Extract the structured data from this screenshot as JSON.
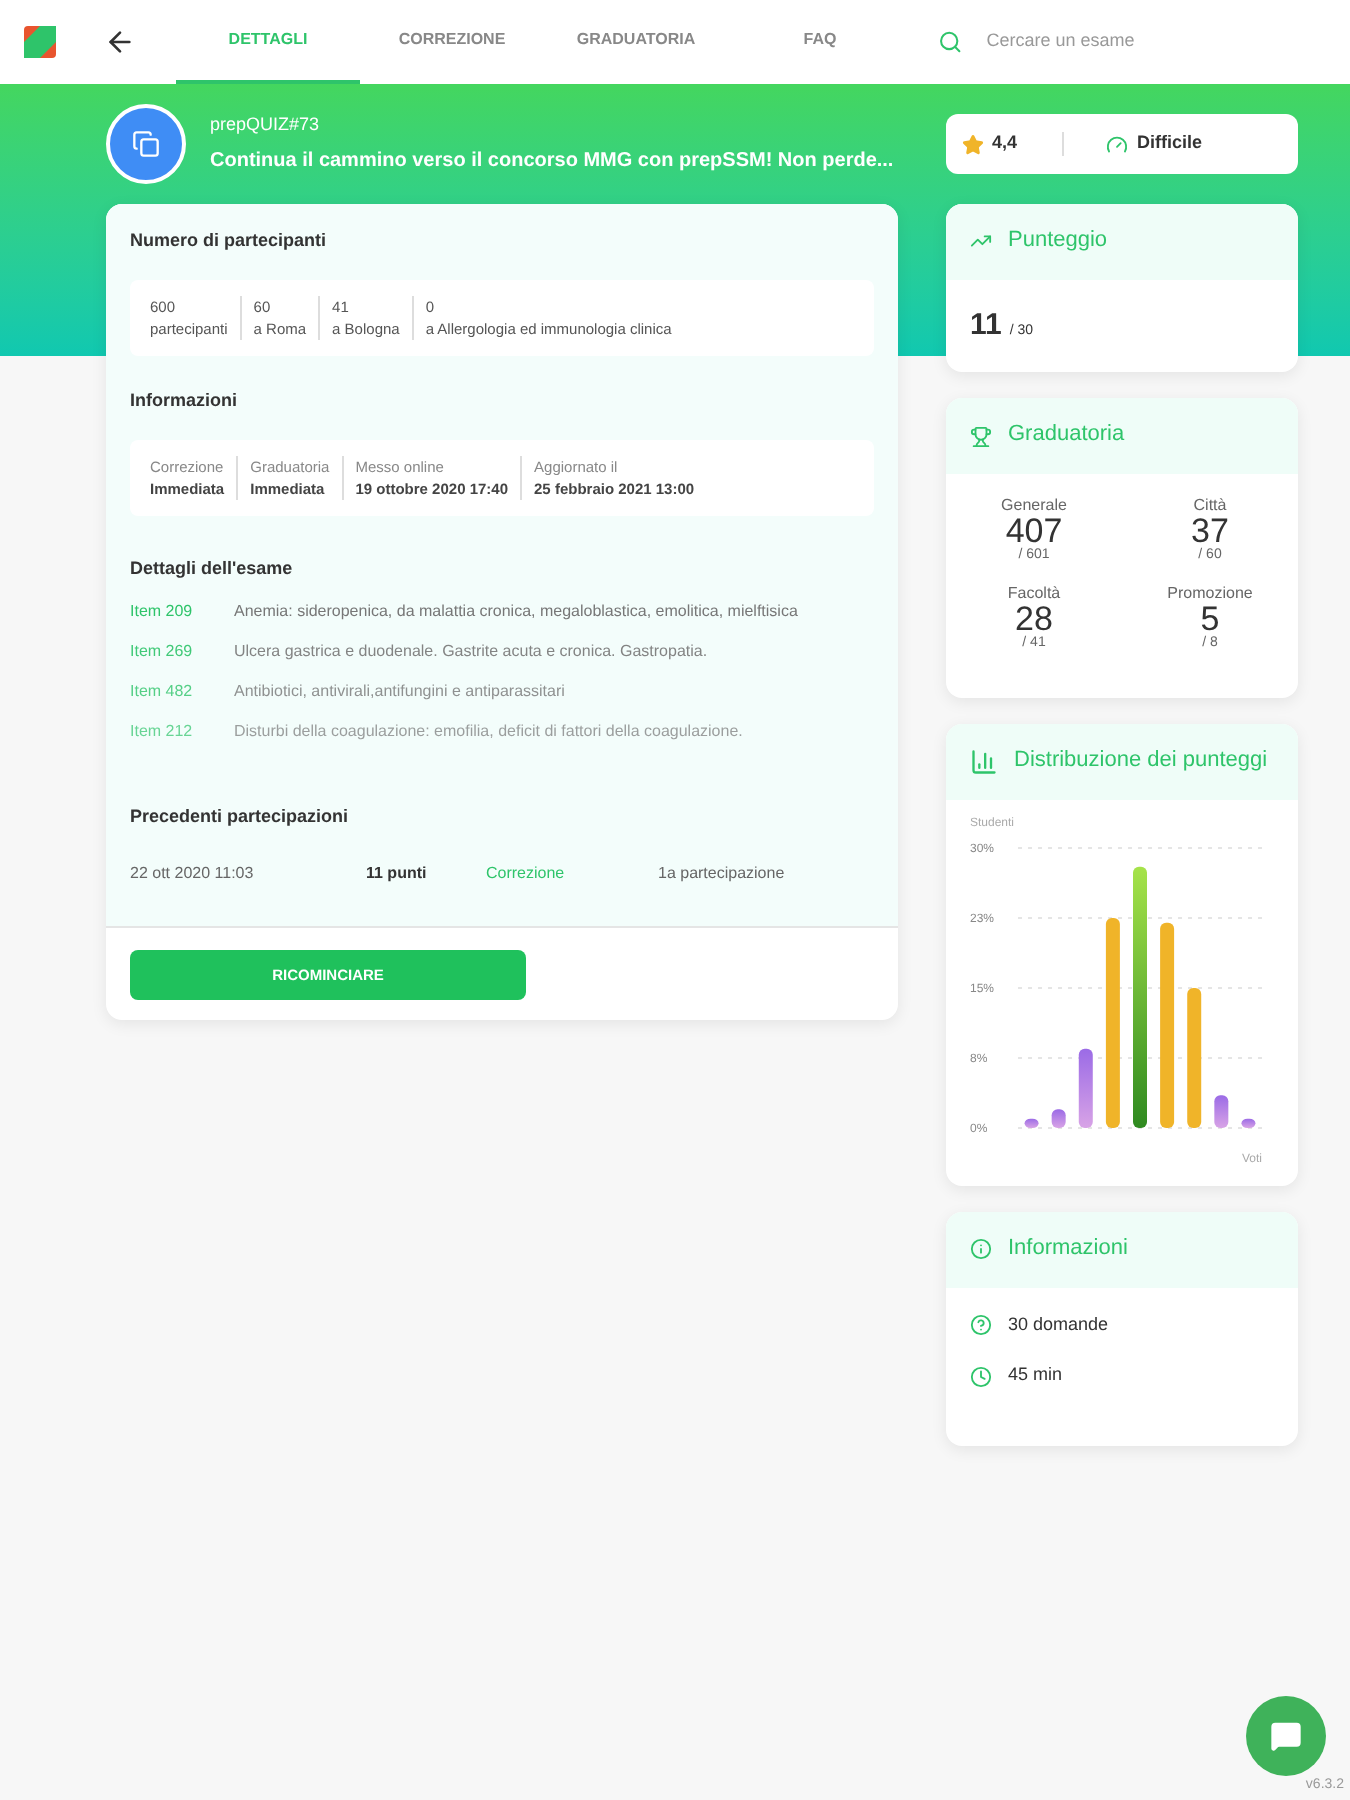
{
  "nav": {
    "tabs": [
      {
        "label": "DETTAGLI",
        "selected": true
      },
      {
        "label": "CORREZIONE",
        "selected": false
      },
      {
        "label": "GRADUATORIA",
        "selected": false
      },
      {
        "label": "FAQ",
        "selected": false
      }
    ],
    "search": {
      "placeholder": "Cercare un esame"
    }
  },
  "exam": {
    "code": "prepQUIZ#73",
    "title": "Continua il cammino verso il concorso MMG con prepSSM! Non perde...",
    "rating": "4,4",
    "difficulty": "Difficile"
  },
  "participants": {
    "title": "Numero di partecipanti",
    "stats": [
      {
        "value": "600",
        "label": "partecipanti"
      },
      {
        "value": "60",
        "label": "a Roma"
      },
      {
        "value": "41",
        "label": "a Bologna"
      },
      {
        "value": "0",
        "label": "a Allergologia ed immunologia clinica"
      }
    ]
  },
  "info": {
    "title": "Informazioni",
    "fields": [
      {
        "label": "Correzione",
        "value": "Immediata"
      },
      {
        "label": "Graduatoria",
        "value": "Immediata"
      },
      {
        "label": "Messo online",
        "value": "19 ottobre 2020 17:40"
      },
      {
        "label": "Aggiornato il",
        "value": "25 febbraio 2021 13:00"
      }
    ]
  },
  "details": {
    "title": "Dettagli dell'esame",
    "items": [
      {
        "code": "Item 209",
        "text": "Anemia: sideropenica, da malattia cronica, megaloblastica, emolitica, mielftisica"
      },
      {
        "code": "Item 269",
        "text": "Ulcera gastrica e duodenale. Gastrite acuta e cronica. Gastropatia."
      },
      {
        "code": "Item 482",
        "text": "Antibiotici, antivirali,antifungini e antiparassitari"
      },
      {
        "code": "Item 212",
        "text": "Disturbi della coagulazione: emofilia, deficit di fattori della coagulazione."
      }
    ]
  },
  "previous": {
    "title": "Precedenti partecipazioni",
    "rows": [
      {
        "date": "22 ott 2020 11:03",
        "score": "11 punti",
        "link": "Correzione",
        "attempt": "1a partecipazione"
      }
    ]
  },
  "restart_button": "RICOMINCIARE",
  "score": {
    "title": "Punteggio",
    "value": "11",
    "total": "/ 30"
  },
  "ranking": {
    "title": "Graduatoria",
    "cells": [
      {
        "label": "Generale",
        "value": "407",
        "total": "/ 601"
      },
      {
        "label": "Città",
        "value": "37",
        "total": "/ 60"
      },
      {
        "label": "Facoltà",
        "value": "28",
        "total": "/ 41"
      },
      {
        "label": "Promozione",
        "value": "5",
        "total": "/ 8"
      }
    ]
  },
  "distribution": {
    "title": "Distribuzione dei punteggi",
    "chart_data": {
      "type": "bar",
      "grid": true,
      "xlabel": "Voti",
      "ylabel": "Studenti",
      "ylim": [
        0,
        30
      ],
      "yticks": [
        {
          "value": 0,
          "label": "0%"
        },
        {
          "value": 7.5,
          "label": "8%"
        },
        {
          "value": 15,
          "label": "15%"
        },
        {
          "value": 22.5,
          "label": "23%"
        },
        {
          "value": 30,
          "label": "30%"
        }
      ],
      "values": [
        1,
        2,
        8.5,
        22.5,
        28,
        22,
        15,
        3.5,
        1
      ]
    }
  },
  "summary": {
    "title": "Informazioni",
    "items": [
      {
        "kind": "questions",
        "text": "30 domande"
      },
      {
        "kind": "time",
        "text": "45 min"
      }
    ]
  },
  "version": "v6.3.2"
}
